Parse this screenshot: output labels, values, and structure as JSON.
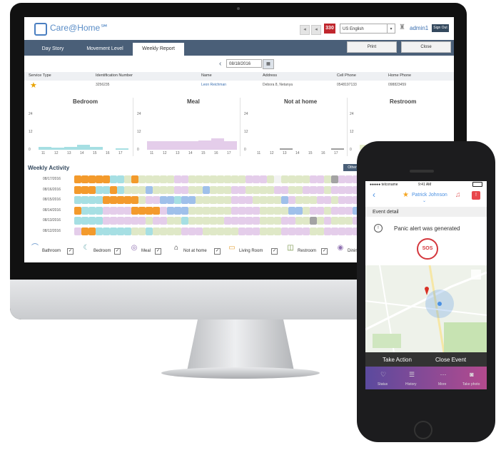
{
  "header": {
    "logo": "Care@Home℠",
    "nav_back": "◂",
    "nav_fwd": "◂",
    "notification_count": "330",
    "language": "US English",
    "user": "admin1",
    "signout": "Sign Out"
  },
  "tabs": [
    {
      "label": "Day Story"
    },
    {
      "label": "Movement Level"
    },
    {
      "label": "Weekly Report"
    }
  ],
  "actions": {
    "print": "Print",
    "close": "Close"
  },
  "date": {
    "value": "08/18/2016"
  },
  "table": {
    "headers": [
      "Service Type",
      "Identification Number",
      "Name",
      "Address",
      "Cell Phone",
      "Home Phone"
    ],
    "row": [
      "",
      "3256235",
      "Leon Reichman",
      "Debora 8, Netanya",
      "0548197133",
      "098823459"
    ]
  },
  "charts": [
    {
      "title": "Bedroom",
      "y_ticks": [
        "24",
        "12",
        "0"
      ],
      "x_ticks": [
        "11",
        "12",
        "13",
        "14",
        "15",
        "16",
        "17"
      ],
      "color": "#a6dfe3"
    },
    {
      "title": "Meal",
      "y_ticks": [
        "24",
        "12",
        "0"
      ],
      "x_ticks": [
        "11",
        "12",
        "13",
        "14",
        "15",
        "16",
        "17"
      ],
      "color": "#e4cdea"
    },
    {
      "title": "Not at home",
      "y_ticks": [
        "24",
        "12",
        "0"
      ],
      "x_ticks": [
        "11",
        "12",
        "13",
        "14",
        "15",
        "16",
        "17"
      ],
      "color": "#9e9e9e"
    },
    {
      "title": "Restroom",
      "y_ticks": [
        "24",
        "12",
        "0"
      ],
      "x_ticks": [
        "11"
      ],
      "color": "#e8efcc"
    }
  ],
  "weekly": {
    "title": "Weekly Activity",
    "other_button": "Other R",
    "days": [
      "08/17/2016",
      "08/16/2016",
      "08/15/2016",
      "08/14/2016",
      "08/13/2016",
      "08/12/2016"
    ]
  },
  "legend": [
    {
      "label": "Bathroom",
      "icon": "shower-icon"
    },
    {
      "label": "Bedroom",
      "icon": "bed-icon"
    },
    {
      "label": "Meal",
      "icon": "meal-icon"
    },
    {
      "label": "Not at home",
      "icon": "house-icon"
    },
    {
      "label": "Living Room",
      "icon": "sofa-icon"
    },
    {
      "label": "Restroom",
      "icon": "toilet-icon"
    },
    {
      "label": "Dinin",
      "icon": "dining-icon"
    }
  ],
  "phone": {
    "carrier": "●●●●● telconame",
    "time": "9:41 AM",
    "patient": "Patrick Johnson",
    "badge": "!",
    "event_detail": "Event detail",
    "alert": "Panic alert was generated",
    "sos": "SOS",
    "take_action": "Take Action",
    "close_event": "Close Event",
    "tabs": [
      "Status",
      "History",
      "More",
      "Take photo"
    ]
  },
  "colors": {
    "brand": "#4a5f78",
    "orange": "#f39a2c",
    "teal": "#a6dfe3",
    "lavender": "#e4cdea",
    "olive": "#dfe8c7",
    "alert": "#c0262d"
  }
}
